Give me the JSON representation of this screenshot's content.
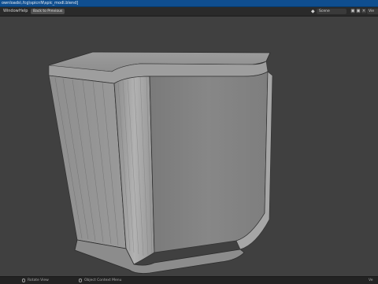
{
  "titlebar": {
    "title": "ownloads\\.fcg\\spicnN\\spic_modl.blend]"
  },
  "menubar": {
    "items": [
      "Window",
      "Help"
    ],
    "back_button": "Back to Previous"
  },
  "header": {
    "scene_label": "Scene",
    "scene_icon": "scene-icon",
    "view_layer_label": "Vie"
  },
  "statusbar": {
    "left": "Rotate View",
    "middle": "Object Context Menu",
    "right": "Ve"
  },
  "colors": {
    "title_bar": "#0f4e8f",
    "menu_bar": "#2a2a2a",
    "viewport_bg": "#404040",
    "status_bar": "#232323"
  }
}
